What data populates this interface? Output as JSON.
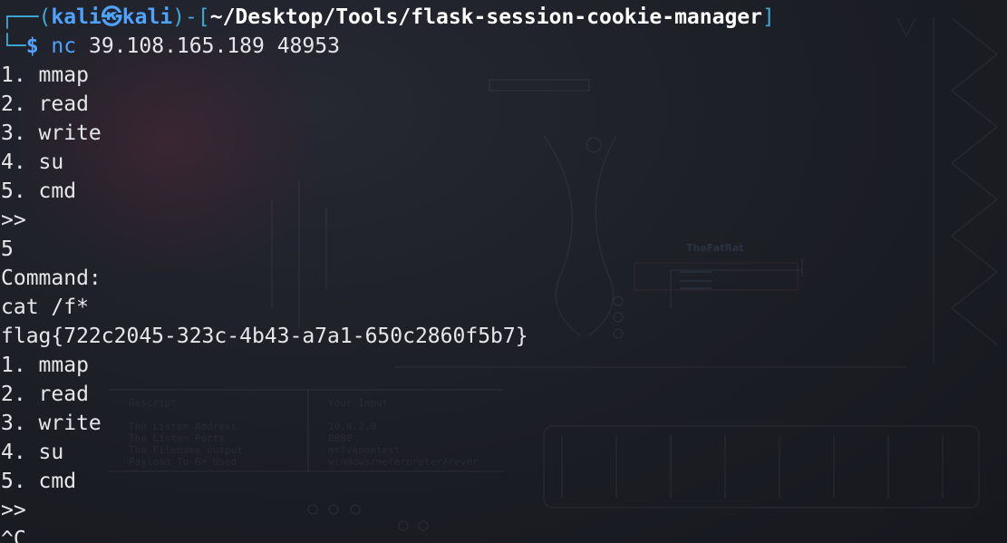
{
  "prompt": {
    "frame_top": "┌──(",
    "user_host": "kali㉿kali",
    "frame_mid": ")-[",
    "path": "~/Desktop/Tools/flask-session-cookie-manager",
    "frame_end": "]",
    "frame_bottom": "└─",
    "dollar": "$",
    "command_name": "nc",
    "command_args": "39.108.165.189 48953"
  },
  "output_lines": [
    "1. mmap",
    "2. read",
    "3. write",
    "4. su",
    "5. cmd",
    ">>",
    "5",
    "Command:",
    "cat /f*",
    "flag{722c2045-323c-4b43-a7a1-650c2860f5b7}",
    "1. mmap",
    "2. read",
    "3. write",
    "4. su",
    "5. cmd",
    ">>",
    "^C"
  ],
  "colors": {
    "background": "#1d1f27",
    "prompt_frame": "#3ea8d8",
    "prompt_user": "#4fa3ff",
    "text": "#e6e7ea"
  }
}
